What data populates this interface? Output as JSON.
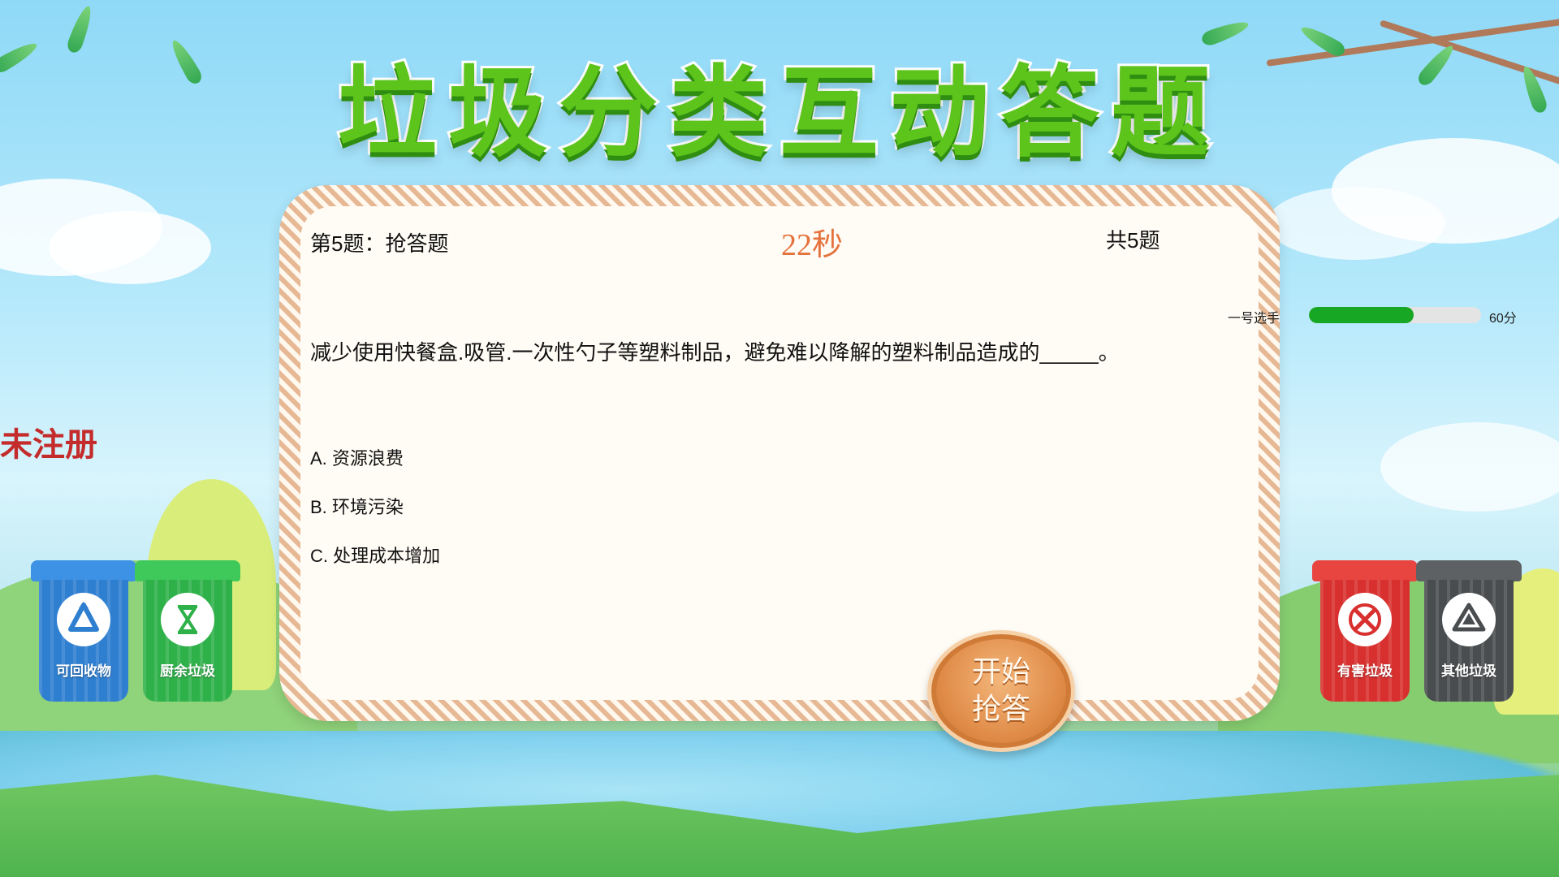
{
  "title": "垃圾分类互动答题",
  "watermark": "未注册",
  "question": {
    "header": "第5题：抢答题",
    "timer": "22秒",
    "total": "共5题",
    "text": "减少使用快餐盒.吸管.一次性勺子等塑料制品，避免难以降解的塑料制品造成的_____。",
    "options": [
      "A. 资源浪费",
      "B. 环境污染",
      "C. 处理成本增加"
    ]
  },
  "score": {
    "player": "一号选手",
    "score_text": "60分",
    "progress_fraction": 0.61,
    "bar_color": "#17a724"
  },
  "start_button": {
    "label": "开始抢答"
  },
  "bins": [
    {
      "label": "可回收物",
      "icon": "recycle-icon",
      "color": "#2f7fd1",
      "lid": "#3d92e6"
    },
    {
      "label": "厨余垃圾",
      "icon": "hourglass-icon",
      "color": "#2fb14a",
      "lid": "#3ec95a"
    },
    {
      "label": "有害垃圾",
      "icon": "hazard-icon",
      "color": "#d8302e",
      "lid": "#e84541"
    },
    {
      "label": "其他垃圾",
      "icon": "other-icon",
      "color": "#4a4d4f",
      "lid": "#5d6164"
    }
  ],
  "colors": {
    "title_green": "#5cc41a",
    "timer_orange": "#e5723d",
    "watermark_red": "#c42b2b"
  }
}
